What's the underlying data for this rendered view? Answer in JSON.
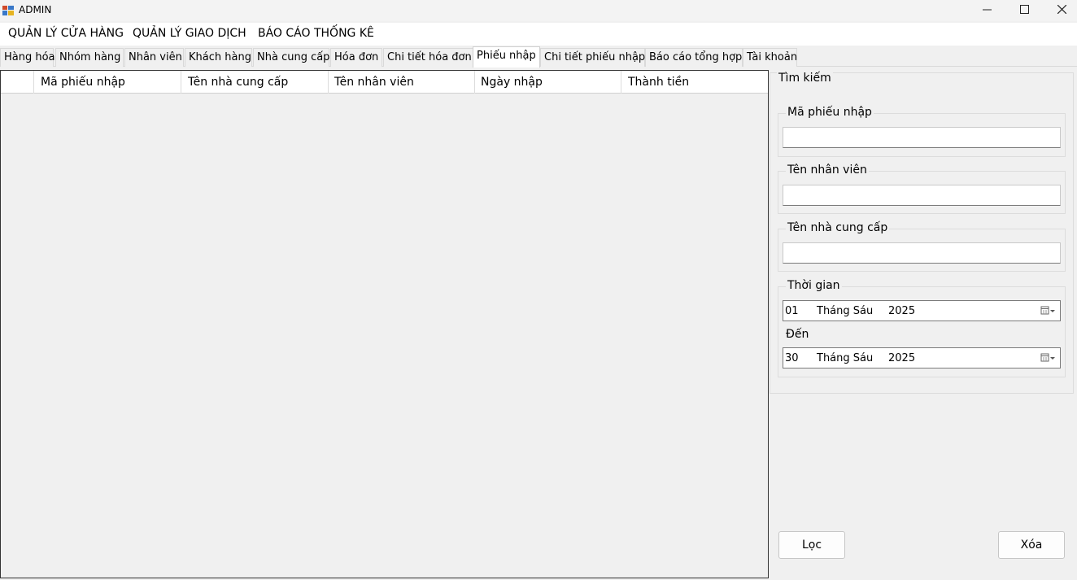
{
  "window": {
    "title": "ADMIN",
    "icons": {
      "app": "app-window-icon",
      "minimize": "minimize-icon",
      "maximize": "maximize-icon",
      "close": "close-icon"
    }
  },
  "menu": {
    "items": [
      "QUẢN LÝ CỬA HÀNG",
      "QUẢN LÝ GIAO DỊCH",
      "BÁO CÁO THỐNG KÊ"
    ]
  },
  "tabs": {
    "items": [
      "Hàng hóa",
      "Nhóm hàng",
      "Nhân viên",
      "Khách hàng",
      "Nhà cung cấp",
      "Hóa đơn",
      "Chi tiết hóa đơn",
      "Phiếu nhập",
      "Chi tiết phiếu nhập",
      "Báo cáo tổng hợp",
      "Tài khoản"
    ],
    "active": "Phiếu nhập"
  },
  "grid": {
    "columns": [
      "Mã phiếu nhập",
      "Tên nhà cung cấp",
      "Tên nhân viên",
      "Ngày nhập",
      "Thành tiền"
    ],
    "rows": []
  },
  "search": {
    "title": "Tìm kiếm",
    "ma_phieu_label": "Mã phiếu nhập",
    "ma_phieu_value": "",
    "nhan_vien_label": "Tên nhân viên",
    "nhan_vien_value": "",
    "nha_cung_cap_label": "Tên nhà cung cấp",
    "nha_cung_cap_value": "",
    "thoi_gian_label": "Thời gian",
    "from": {
      "day": "01",
      "month": "Tháng Sáu",
      "year": "2025"
    },
    "den_label": "Đến",
    "to": {
      "day": "30",
      "month": "Tháng Sáu",
      "year": "2025"
    },
    "calendar_icon": "calendar-dropdown-icon"
  },
  "buttons": {
    "filter": "Lọc",
    "delete": "Xóa"
  }
}
